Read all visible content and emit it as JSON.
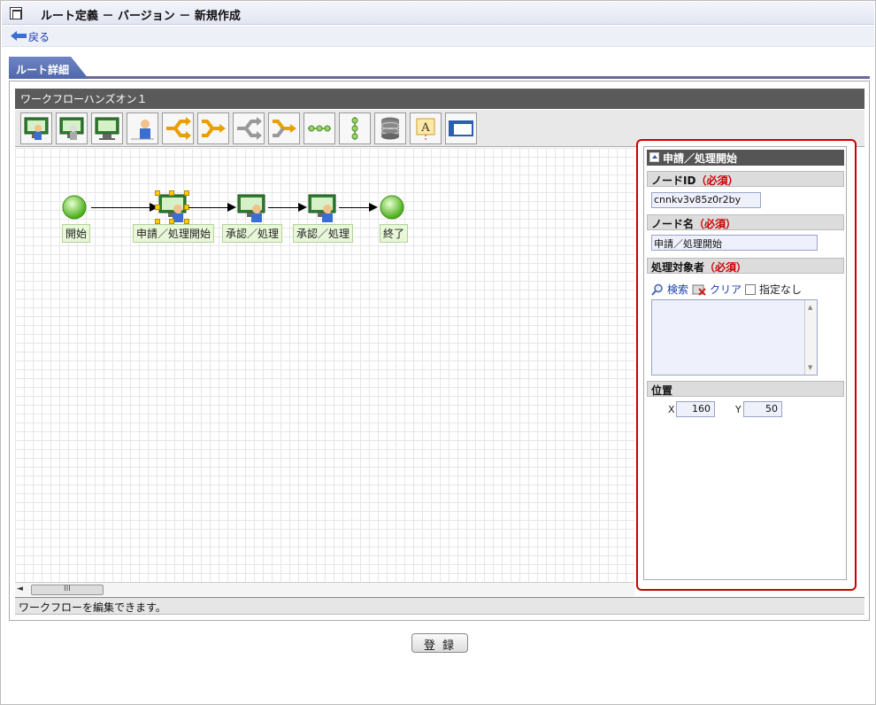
{
  "title": "ルート定義 － バージョン － 新規作成",
  "back_label": "戻る",
  "tab_label": "ルート詳細",
  "workflow_name": "ワークフローハンズオン１",
  "toolbar_icons": [
    "user-node-icon",
    "role-node-icon",
    "system-node-icon",
    "person-icon",
    "branch-start-icon",
    "branch-end-icon",
    "join-start-icon",
    "join-end-icon",
    "sequence-icon",
    "parallel-icon",
    "database-icon",
    "text-annotation-icon",
    "window-icon"
  ],
  "nodes": {
    "start": "開始",
    "apply": "申請／処理開始",
    "approve1": "承認／処理",
    "approve2": "承認／処理",
    "end": "終了"
  },
  "status_text": "ワークフローを編集できます。",
  "side": {
    "title": "申請／処理開始",
    "node_id_label": "ノードID",
    "node_id_required": "（必須）",
    "node_id_value": "cnnkv3v85z0r2by",
    "node_name_label": "ノード名",
    "node_name_required": "（必須）",
    "node_name_value": "申請／処理開始",
    "target_label": "処理対象者",
    "target_required": "（必須）",
    "search_label": "検索",
    "clear_label": "クリア",
    "unspecified_label": "指定なし",
    "position_label": "位置",
    "x_label": "X",
    "x_value": "160",
    "y_label": "Y",
    "y_value": "50"
  },
  "register_label": "登 録",
  "colors": {
    "accent": "#5a6fb8",
    "highlight": "#cc0000"
  }
}
